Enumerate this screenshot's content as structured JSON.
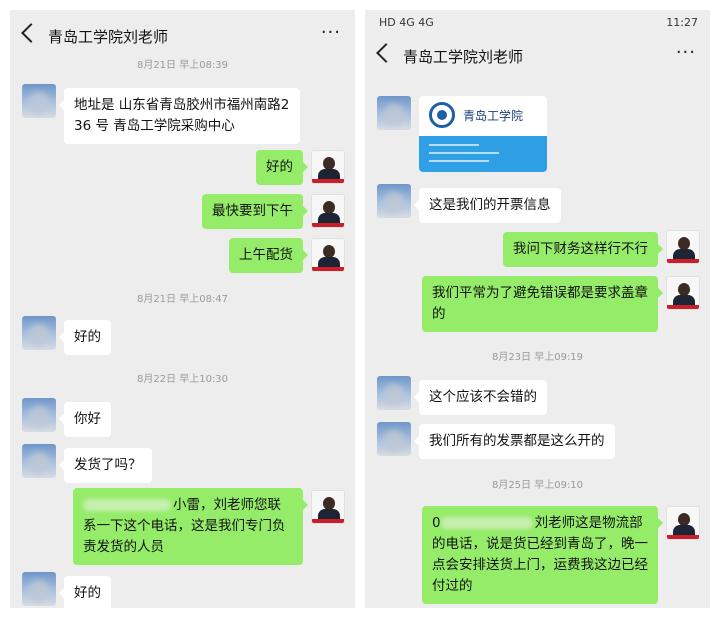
{
  "left": {
    "title": "青岛工学院刘老师",
    "more": "···",
    "messages": {
      "ts1": "8月21日 早上08:39",
      "m1": "地址是 山东省青岛胶州市福州南路236 号 青岛工学院采购中心",
      "m2": "好的",
      "m3": "最快要到下午",
      "m4": "上午配货",
      "ts2": "8月21日 早上08:47",
      "m5": "好的",
      "ts3": "8月22日 早上10:30",
      "m6": "你好",
      "m7": "发货了吗？",
      "m8": "小雷，刘老师您联系一下这个电话，这是我们专门负责发货的人员",
      "m9": "好的"
    }
  },
  "right": {
    "status": {
      "left": "HD 4G 4G",
      "time": "11:27"
    },
    "title": "青岛工学院刘老师",
    "more": "···",
    "card_name": "青岛工学院",
    "messages": {
      "m1": "这是我们的开票信息",
      "m2": "我问下财务这样行不行",
      "m3": "我们平常为了避免错误都是要求盖章的",
      "ts1": "8月23日 早上09:19",
      "m4": "这个应该不会错的",
      "m5": "我们所有的发票都是这么开的",
      "ts2": "8月25日 早上09:10",
      "m6_prefix": "0",
      "m6": "刘老师这是物流部的电话，说是货已经到青岛了，晚一点会安排送货上门，运费我这边已经付过的"
    }
  },
  "colors": {
    "out_bubble": "#95ec69",
    "in_bubble": "#ffffff",
    "chat_bg": "#ededed"
  }
}
